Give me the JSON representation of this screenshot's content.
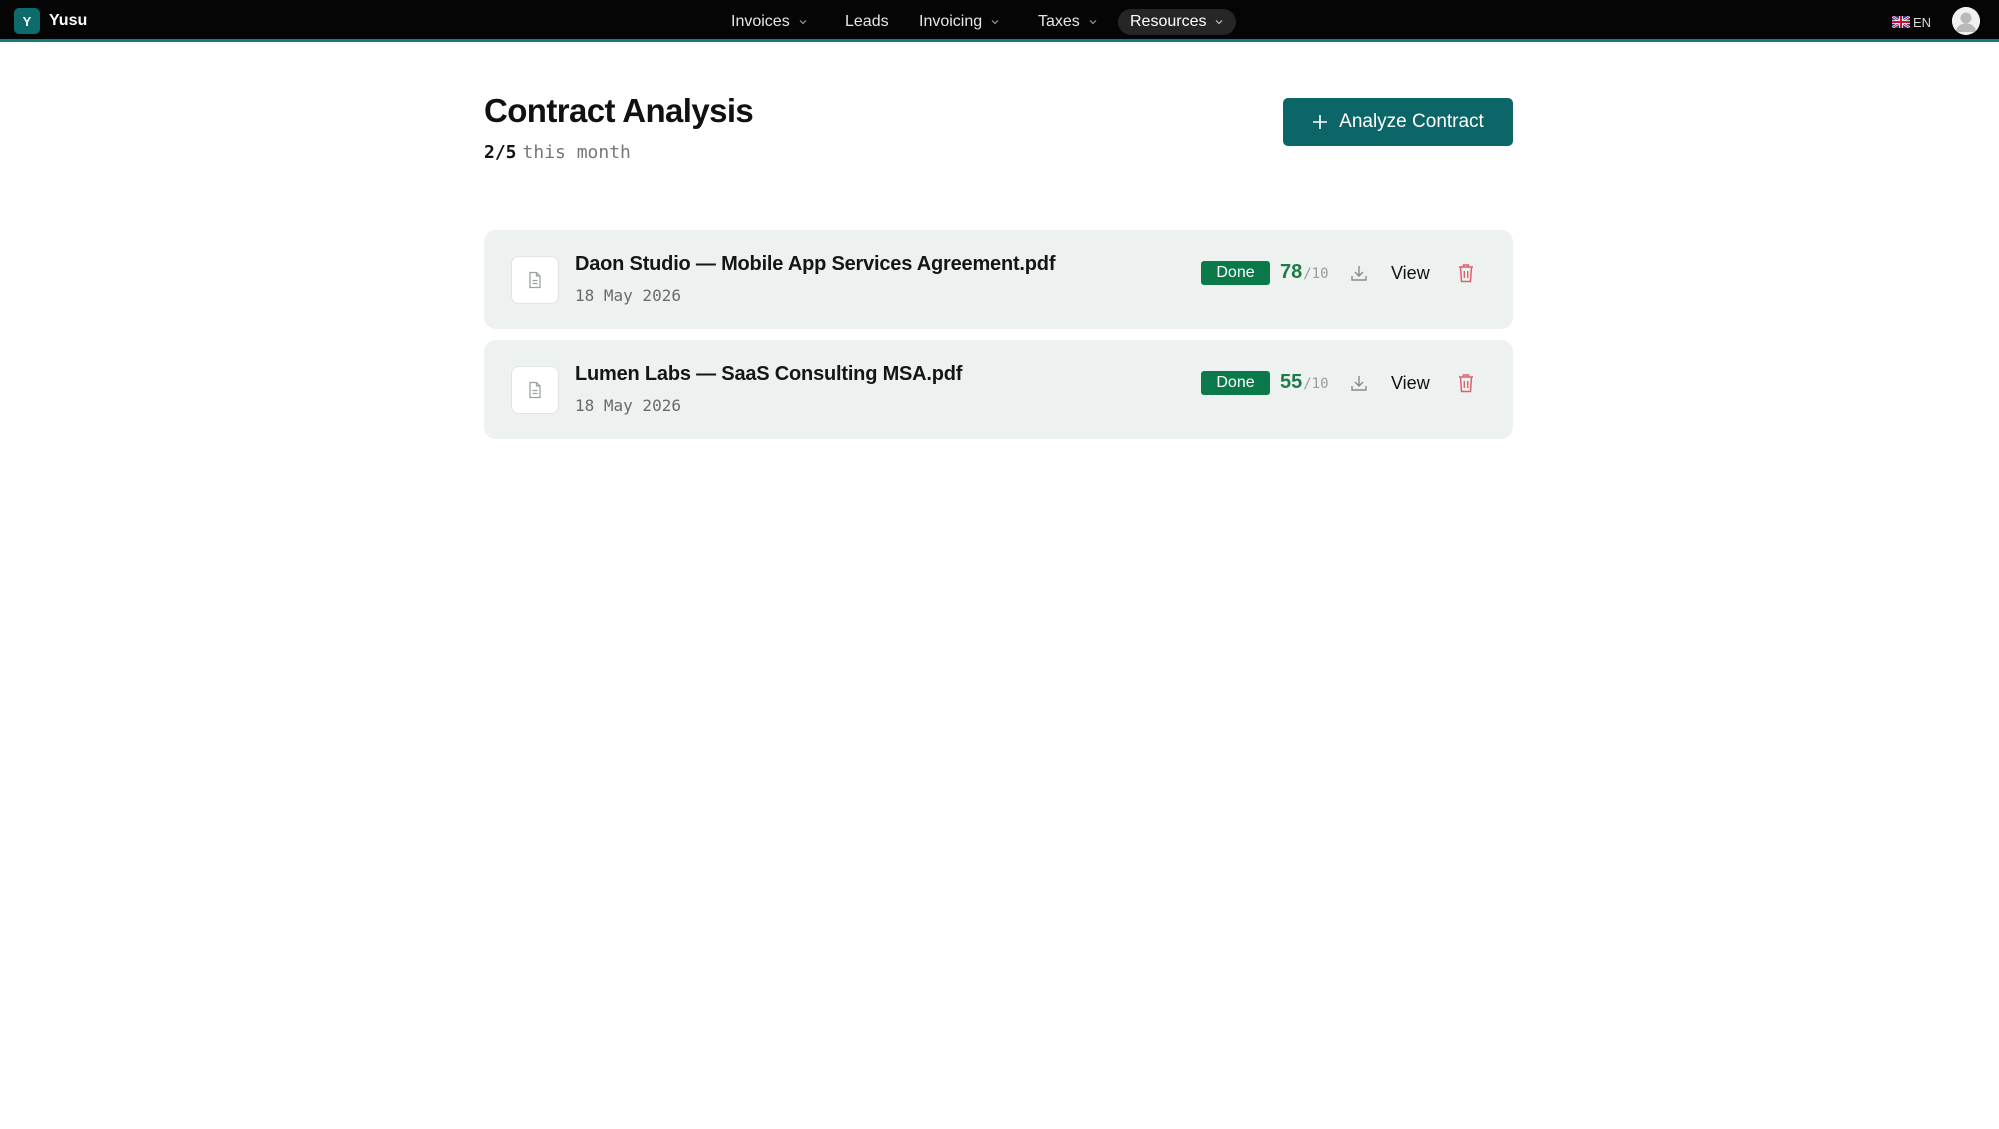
{
  "brand": {
    "logo_letter": "Y",
    "name": "Yusu"
  },
  "nav": {
    "items": [
      {
        "label": "Invoices",
        "has_dropdown": true
      },
      {
        "label": "Leads",
        "has_dropdown": false
      },
      {
        "label": "Invoicing",
        "has_dropdown": true
      },
      {
        "label": "Taxes",
        "has_dropdown": true
      },
      {
        "label": "Resources",
        "has_dropdown": true,
        "active": true
      }
    ],
    "language": "EN",
    "language_flag": "uk-flag-icon"
  },
  "header": {
    "title": "Contract Analysis",
    "usage_count": "2/5",
    "usage_period": "this month",
    "analyze_button_label": "Analyze Contract"
  },
  "contracts": [
    {
      "file_name": "Daon Studio — Mobile App Services Agreement.pdf",
      "date": "18 May 2026",
      "status": "Done",
      "score": "78",
      "score_max": "/10",
      "view_label": "View"
    },
    {
      "file_name": "Lumen Labs — SaaS Consulting MSA.pdf",
      "date": "18 May 2026",
      "status": "Done",
      "score": "55",
      "score_max": "/10",
      "view_label": "View"
    }
  ],
  "colors": {
    "topbar_bg": "#050505",
    "topbar_accent": "#0f8080",
    "primary_button": "#0c6566",
    "status_done": "#0a7a4a",
    "score_green": "#1f7a48",
    "delete_red": "#e0606a",
    "row_bg": "#edf2f1"
  }
}
